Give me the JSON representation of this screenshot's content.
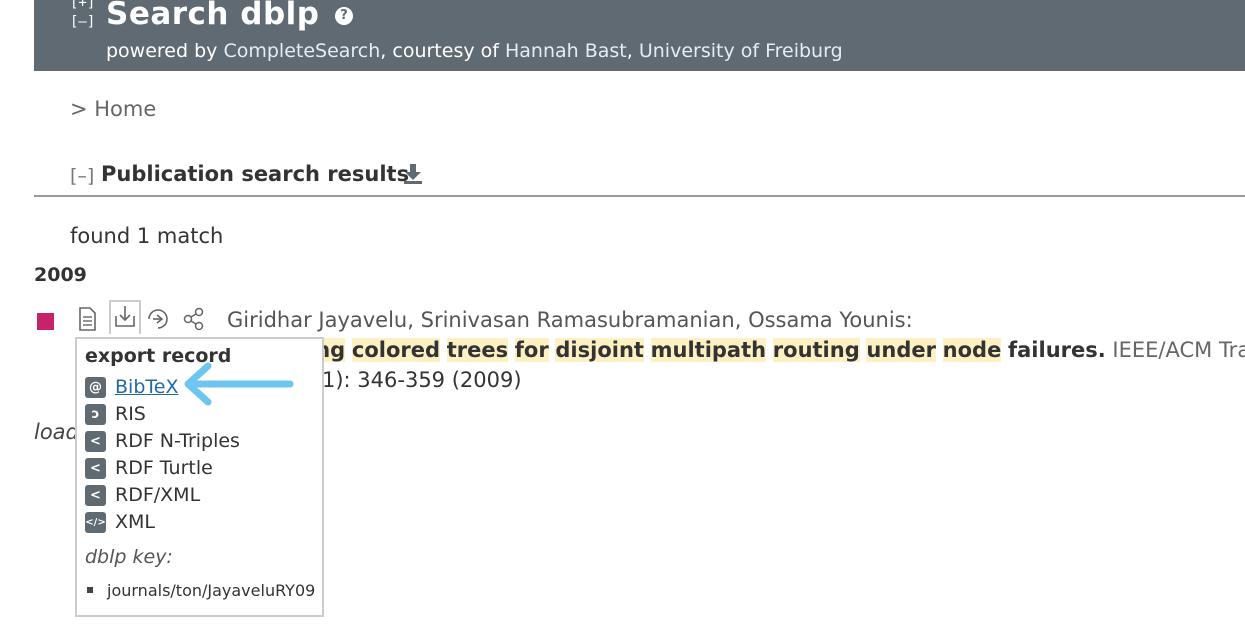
{
  "header": {
    "toggle_expand": "[+]",
    "toggle_collapse": "[–]",
    "title": "Search dblp",
    "help_icon": "question-circle-icon",
    "sub_prefix": "powered by ",
    "sub_link1": "CompleteSearch",
    "sub_mid": ", courtesy of ",
    "sub_link2": "Hannah Bast",
    "sub_sep": ", ",
    "sub_link3": "University of Freiburg"
  },
  "breadcrumb": "> Home",
  "results": {
    "toggle": "[–]",
    "title": "Publication search results",
    "found": "found 1 match",
    "year": "2009"
  },
  "publication": {
    "authors": [
      {
        "name": "Giridhar Jayavelu",
        "sep": ", "
      },
      {
        "name": "Srinivasan Ramasubramanian",
        "sep": ", "
      },
      {
        "name": "Ossama Younis",
        "sep": ":"
      }
    ],
    "title_words": [
      {
        "text": "ing",
        "hl": true
      },
      {
        "text": " ",
        "hl": false
      },
      {
        "text": "colored",
        "hl": true
      },
      {
        "text": " ",
        "hl": false
      },
      {
        "text": "trees",
        "hl": true
      },
      {
        "text": " ",
        "hl": false
      },
      {
        "text": "for",
        "hl": true
      },
      {
        "text": " ",
        "hl": false
      },
      {
        "text": "disjoint",
        "hl": true
      },
      {
        "text": " ",
        "hl": false
      },
      {
        "text": "multipath",
        "hl": true
      },
      {
        "text": " ",
        "hl": false
      },
      {
        "text": "routing",
        "hl": true
      },
      {
        "text": " ",
        "hl": false
      },
      {
        "text": "under",
        "hl": true
      },
      {
        "text": " ",
        "hl": false
      },
      {
        "text": "node",
        "hl": true
      },
      {
        "text": " ",
        "hl": false
      },
      {
        "text": "failures.",
        "hl": false
      }
    ],
    "venue": " IEEE/ACM Trans.",
    "pages": "1): 346-359 (2009)",
    "loading": "load"
  },
  "export_popup": {
    "heading": "export record",
    "items": [
      {
        "label": "BibTeX",
        "icon": "at-sign-icon",
        "glyph": "@"
      },
      {
        "label": "RIS",
        "icon": "ris-icon",
        "glyph": "ↄ"
      },
      {
        "label": "RDF N-Triples",
        "icon": "share-icon",
        "glyph": "<"
      },
      {
        "label": "RDF Turtle",
        "icon": "share-icon",
        "glyph": "<"
      },
      {
        "label": "RDF/XML",
        "icon": "share-icon",
        "glyph": "<"
      },
      {
        "label": "XML",
        "icon": "code-icon",
        "glyph": "</>"
      }
    ],
    "key_label": "dblp key:",
    "key_value": "journals/ton/JayaveluRY09"
  },
  "colors": {
    "header_bg": "#5f6a72",
    "pub_marker": "#c7236a",
    "highlight": "#fdf0c2",
    "link": "#2368a7",
    "arrow": "#6ec6f0"
  }
}
